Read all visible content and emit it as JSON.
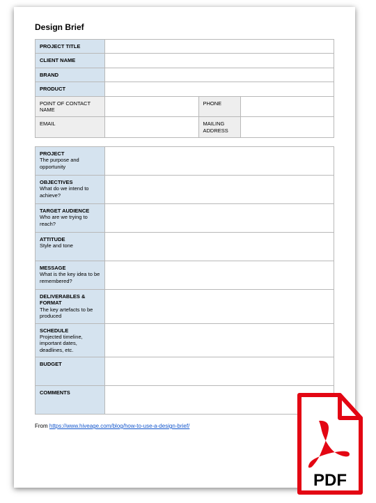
{
  "title": "Design Brief",
  "header_rows": {
    "project_title": {
      "label": "PROJECT TITLE",
      "value": ""
    },
    "client_name": {
      "label": "CLIENT NAME",
      "value": ""
    },
    "brand": {
      "label": "BRAND",
      "value": ""
    },
    "product": {
      "label": "PRODUCT",
      "value": ""
    }
  },
  "contact": {
    "poc_label": "POINT OF CONTACT NAME",
    "poc_value": "",
    "phone_label": "PHONE",
    "phone_value": "",
    "email_label": "EMAIL",
    "email_value": "",
    "mailing_label": "MAILING ADDRESS",
    "mailing_value": ""
  },
  "sections": {
    "project": {
      "title": "PROJECT",
      "sub": "The purpose and opportunity",
      "value": ""
    },
    "objectives": {
      "title": "OBJECTIVES",
      "sub": "What do we intend to achieve?",
      "value": ""
    },
    "target": {
      "title": "TARGET AUDIENCE",
      "sub": "Who are we trying to reach?",
      "value": ""
    },
    "attitude": {
      "title": "ATTITUDE",
      "sub": "Style and tone",
      "value": ""
    },
    "message": {
      "title": "MESSAGE",
      "sub": "What is the key idea to be remembered?",
      "value": ""
    },
    "deliverables": {
      "title": "DELIVERABLES & FORMAT",
      "sub": "The key artefacts to be produced",
      "value": ""
    },
    "schedule": {
      "title": "SCHEDULE",
      "sub": "Projected timeline, important dates, deadlines, etc.",
      "value": ""
    },
    "budget": {
      "title": "BUDGET",
      "sub": "",
      "value": ""
    },
    "comments": {
      "title": "COMMENTS",
      "sub": "",
      "value": ""
    }
  },
  "footer": {
    "prefix": "From ",
    "link_text": "https://www.hiveage.com/blog/how-to-use-a-design-brief/"
  },
  "badge": {
    "label": "PDF"
  }
}
